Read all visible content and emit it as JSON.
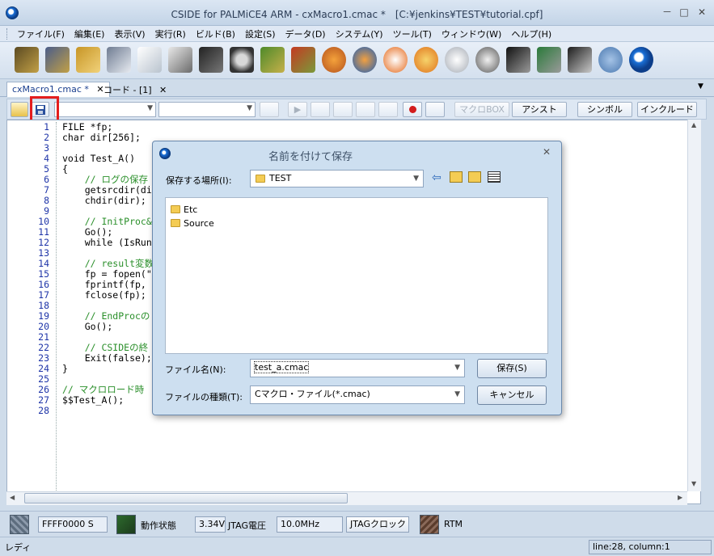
{
  "window": {
    "title": "CSIDE for PALMiCE4 ARM - cxMacro1.cmac *　[C:¥jenkins¥TEST¥tutorial.cpf]",
    "min": "－",
    "max": "□",
    "close": "✕"
  },
  "menu": [
    "ファイル(F)",
    "編集(E)",
    "表示(V)",
    "実行(R)",
    "ビルド(B)",
    "設定(S)",
    "データ(D)",
    "システム(Y)",
    "ツール(T)",
    "ウィンドウ(W)",
    "ヘルプ(H)"
  ],
  "tabs": [
    {
      "label": "cxMacro1.cmac *",
      "close": "✕"
    },
    {
      "label": "コード - [1]",
      "close": "✕"
    }
  ],
  "tab_menu_arrow": "▼",
  "editor_toolbar": {
    "macro_box": "マクロBOX",
    "assist": "アシスト",
    "symbol": "シンボル",
    "include": "インクルード"
  },
  "code_lines": [
    {
      "n": "1",
      "text": "FILE *fp;",
      "cls": ""
    },
    {
      "n": "2",
      "text": "char dir[256];",
      "cls": ""
    },
    {
      "n": "3",
      "text": "",
      "cls": ""
    },
    {
      "n": "4",
      "text": "void Test_A()",
      "cls": ""
    },
    {
      "n": "5",
      "text": "{",
      "cls": ""
    },
    {
      "n": "6",
      "text": "    // ログの保存",
      "cls": "cm"
    },
    {
      "n": "7",
      "text": "    getsrcdir(di",
      "cls": ""
    },
    {
      "n": "8",
      "text": "    chdir(dir);",
      "cls": ""
    },
    {
      "n": "9",
      "text": "",
      "cls": ""
    },
    {
      "n": "10",
      "text": "    // InitProc&",
      "cls": "cm"
    },
    {
      "n": "11",
      "text": "    Go();",
      "cls": ""
    },
    {
      "n": "12",
      "text": "    while (IsRun",
      "cls": ""
    },
    {
      "n": "13",
      "text": "",
      "cls": ""
    },
    {
      "n": "14",
      "text": "    // result変数",
      "cls": "cm"
    },
    {
      "n": "15",
      "text": "    fp = fopen(\"",
      "cls": ""
    },
    {
      "n": "16",
      "text": "    fprintf(fp,",
      "cls": ""
    },
    {
      "n": "17",
      "text": "    fclose(fp);",
      "cls": ""
    },
    {
      "n": "18",
      "text": "",
      "cls": ""
    },
    {
      "n": "19",
      "text": "    // EndProcの",
      "cls": "cm"
    },
    {
      "n": "20",
      "text": "    Go();",
      "cls": ""
    },
    {
      "n": "21",
      "text": "",
      "cls": ""
    },
    {
      "n": "22",
      "text": "    // CSIDEの終",
      "cls": "cm"
    },
    {
      "n": "23",
      "text": "    Exit(false);",
      "cls": ""
    },
    {
      "n": "24",
      "text": "}",
      "cls": ""
    },
    {
      "n": "25",
      "text": "",
      "cls": ""
    },
    {
      "n": "26",
      "text": "// マクロロード時",
      "cls": "cm"
    },
    {
      "n": "27",
      "text": "$$Test_A();",
      "cls": ""
    },
    {
      "n": "28",
      "text": "",
      "cls": ""
    }
  ],
  "dialog": {
    "title": "名前を付けて保存",
    "close": "✕",
    "location_label": "保存する場所(I):",
    "location_value": "TEST",
    "folders": [
      "Etc",
      "Source"
    ],
    "filename_label": "ファイル名(N):",
    "filename_value": "test_a.cmac",
    "filetype_label": "ファイルの種類(T):",
    "filetype_value": "Cマクロ・ファイル(*.cmac)",
    "save_button": "保存(S)",
    "cancel_button": "キャンセル"
  },
  "status_panel": {
    "address": "FFFF0000 S",
    "state_label": "動作状態",
    "voltage": "3.34V",
    "voltage_label": "JTAG電圧",
    "clock": "10.0MHz",
    "clock_button": "JTAGクロック",
    "rtm": "RTM"
  },
  "statusbar": {
    "left": "レディ",
    "position": "line:28, column:1"
  },
  "colors": {
    "highlight_box": "#e41d1d",
    "comment": "#2a8f2a",
    "line_number": "#1f35a8"
  }
}
